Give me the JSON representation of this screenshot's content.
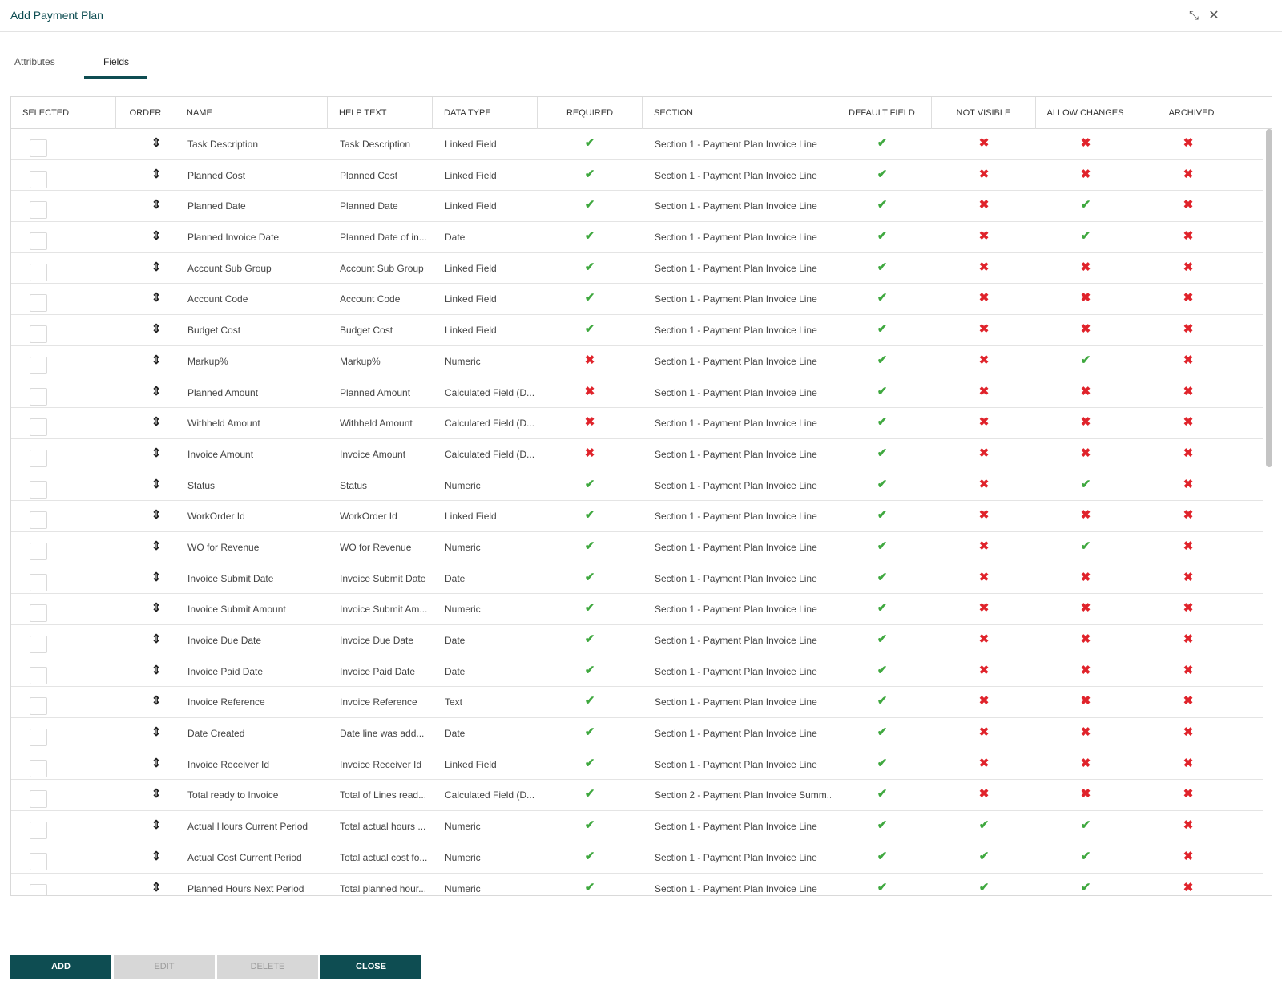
{
  "window": {
    "title": "Add Payment Plan",
    "collapse_glyph": "⤡",
    "close_glyph": "✕"
  },
  "tabs": [
    {
      "label": "Attributes",
      "active": false
    },
    {
      "label": "Fields",
      "active": true
    }
  ],
  "colors": {
    "accent": "#0e4d52",
    "check": "#3fa83f",
    "cross": "#e0232b",
    "disabled": "#d7d7d7"
  },
  "icons": {
    "order": "⇕",
    "check": "✔",
    "cross": "✖"
  },
  "table": {
    "columns": [
      "SELECTED",
      "ORDER",
      "NAME",
      "HELP TEXT",
      "DATA TYPE",
      "REQUIRED",
      "SECTION",
      "DEFAULT FIELD",
      "NOT VISIBLE",
      "ALLOW CHANGES",
      "ARCHIVED"
    ],
    "rows": [
      {
        "name": "Task Description",
        "help": "Task Description",
        "type": "Linked Field",
        "section": "Section 1 - Payment Plan Invoice Line",
        "required": true,
        "default": true,
        "not_visible": false,
        "allow_changes": false,
        "archived": false
      },
      {
        "name": "Planned Cost",
        "help": "Planned Cost",
        "type": "Linked Field",
        "section": "Section 1 - Payment Plan Invoice Line",
        "required": true,
        "default": true,
        "not_visible": false,
        "allow_changes": false,
        "archived": false
      },
      {
        "name": "Planned Date",
        "help": "Planned Date",
        "type": "Linked Field",
        "section": "Section 1 - Payment Plan Invoice Line",
        "required": true,
        "default": true,
        "not_visible": false,
        "allow_changes": true,
        "archived": false
      },
      {
        "name": "Planned Invoice Date",
        "help": "Planned Date of in...",
        "type": "Date",
        "section": "Section 1 - Payment Plan Invoice Line",
        "required": true,
        "default": true,
        "not_visible": false,
        "allow_changes": true,
        "archived": false
      },
      {
        "name": "Account Sub Group",
        "help": "Account Sub Group",
        "type": "Linked Field",
        "section": "Section 1 - Payment Plan Invoice Line",
        "required": true,
        "default": true,
        "not_visible": false,
        "allow_changes": false,
        "archived": false
      },
      {
        "name": "Account Code",
        "help": "Account Code",
        "type": "Linked Field",
        "section": "Section 1 - Payment Plan Invoice Line",
        "required": true,
        "default": true,
        "not_visible": false,
        "allow_changes": false,
        "archived": false
      },
      {
        "name": "Budget Cost",
        "help": "Budget Cost",
        "type": "Linked Field",
        "section": "Section 1 - Payment Plan Invoice Line",
        "required": true,
        "default": true,
        "not_visible": false,
        "allow_changes": false,
        "archived": false
      },
      {
        "name": "Markup%",
        "help": "Markup%",
        "type": "Numeric",
        "section": "Section 1 - Payment Plan Invoice Line",
        "required": false,
        "default": true,
        "not_visible": false,
        "allow_changes": true,
        "archived": false
      },
      {
        "name": "Planned Amount",
        "help": "Planned Amount",
        "type": "Calculated Field (D...",
        "section": "Section 1 - Payment Plan Invoice Line",
        "required": false,
        "default": true,
        "not_visible": false,
        "allow_changes": false,
        "archived": false
      },
      {
        "name": "Withheld Amount",
        "help": "Withheld Amount",
        "type": "Calculated Field (D...",
        "section": "Section 1 - Payment Plan Invoice Line",
        "required": false,
        "default": true,
        "not_visible": false,
        "allow_changes": false,
        "archived": false
      },
      {
        "name": "Invoice Amount",
        "help": "Invoice Amount",
        "type": "Calculated Field (D...",
        "section": "Section 1 - Payment Plan Invoice Line",
        "required": false,
        "default": true,
        "not_visible": false,
        "allow_changes": false,
        "archived": false
      },
      {
        "name": "Status",
        "help": "Status",
        "type": "Numeric",
        "section": "Section 1 - Payment Plan Invoice Line",
        "required": true,
        "default": true,
        "not_visible": false,
        "allow_changes": true,
        "archived": false
      },
      {
        "name": "WorkOrder Id",
        "help": "WorkOrder Id",
        "type": "Linked Field",
        "section": "Section 1 - Payment Plan Invoice Line",
        "required": true,
        "default": true,
        "not_visible": false,
        "allow_changes": false,
        "archived": false
      },
      {
        "name": "WO for Revenue",
        "help": "WO for Revenue",
        "type": "Numeric",
        "section": "Section 1 - Payment Plan Invoice Line",
        "required": true,
        "default": true,
        "not_visible": false,
        "allow_changes": true,
        "archived": false
      },
      {
        "name": "Invoice Submit Date",
        "help": "Invoice Submit Date",
        "type": "Date",
        "section": "Section 1 - Payment Plan Invoice Line",
        "required": true,
        "default": true,
        "not_visible": false,
        "allow_changes": false,
        "archived": false
      },
      {
        "name": "Invoice Submit Amount",
        "help": "Invoice Submit Am...",
        "type": "Numeric",
        "section": "Section 1 - Payment Plan Invoice Line",
        "required": true,
        "default": true,
        "not_visible": false,
        "allow_changes": false,
        "archived": false
      },
      {
        "name": "Invoice Due Date",
        "help": "Invoice Due Date",
        "type": "Date",
        "section": "Section 1 - Payment Plan Invoice Line",
        "required": true,
        "default": true,
        "not_visible": false,
        "allow_changes": false,
        "archived": false
      },
      {
        "name": "Invoice Paid Date",
        "help": "Invoice Paid Date",
        "type": "Date",
        "section": "Section 1 - Payment Plan Invoice Line",
        "required": true,
        "default": true,
        "not_visible": false,
        "allow_changes": false,
        "archived": false
      },
      {
        "name": "Invoice Reference",
        "help": "Invoice Reference",
        "type": "Text",
        "section": "Section 1 - Payment Plan Invoice Line",
        "required": true,
        "default": true,
        "not_visible": false,
        "allow_changes": false,
        "archived": false
      },
      {
        "name": "Date Created",
        "help": "Date line was add...",
        "type": "Date",
        "section": "Section 1 - Payment Plan Invoice Line",
        "required": true,
        "default": true,
        "not_visible": false,
        "allow_changes": false,
        "archived": false
      },
      {
        "name": "Invoice Receiver Id",
        "help": "Invoice Receiver Id",
        "type": "Linked Field",
        "section": "Section 1 - Payment Plan Invoice Line",
        "required": true,
        "default": true,
        "not_visible": false,
        "allow_changes": false,
        "archived": false
      },
      {
        "name": "Total ready to Invoice",
        "help": "Total of Lines read...",
        "type": "Calculated Field (D...",
        "section": "Section 2 - Payment Plan Invoice Summ...",
        "required": true,
        "default": true,
        "not_visible": false,
        "allow_changes": false,
        "archived": false
      },
      {
        "name": "Actual Hours Current Period",
        "help": "Total actual hours ...",
        "type": "Numeric",
        "section": "Section 1 - Payment Plan Invoice Line",
        "required": true,
        "default": true,
        "not_visible": true,
        "allow_changes": true,
        "archived": false
      },
      {
        "name": "Actual Cost Current Period",
        "help": "Total actual cost fo...",
        "type": "Numeric",
        "section": "Section 1 - Payment Plan Invoice Line",
        "required": true,
        "default": true,
        "not_visible": true,
        "allow_changes": true,
        "archived": false
      },
      {
        "name": "Planned Hours Next Period",
        "help": "Total planned hour...",
        "type": "Numeric",
        "section": "Section 1 - Payment Plan Invoice Line",
        "required": true,
        "default": true,
        "not_visible": true,
        "allow_changes": true,
        "archived": false
      }
    ]
  },
  "buttons": {
    "add": {
      "label": "ADD",
      "enabled": true
    },
    "edit": {
      "label": "EDIT",
      "enabled": false
    },
    "delete": {
      "label": "DELETE",
      "enabled": false
    },
    "close": {
      "label": "CLOSE",
      "enabled": true
    }
  }
}
